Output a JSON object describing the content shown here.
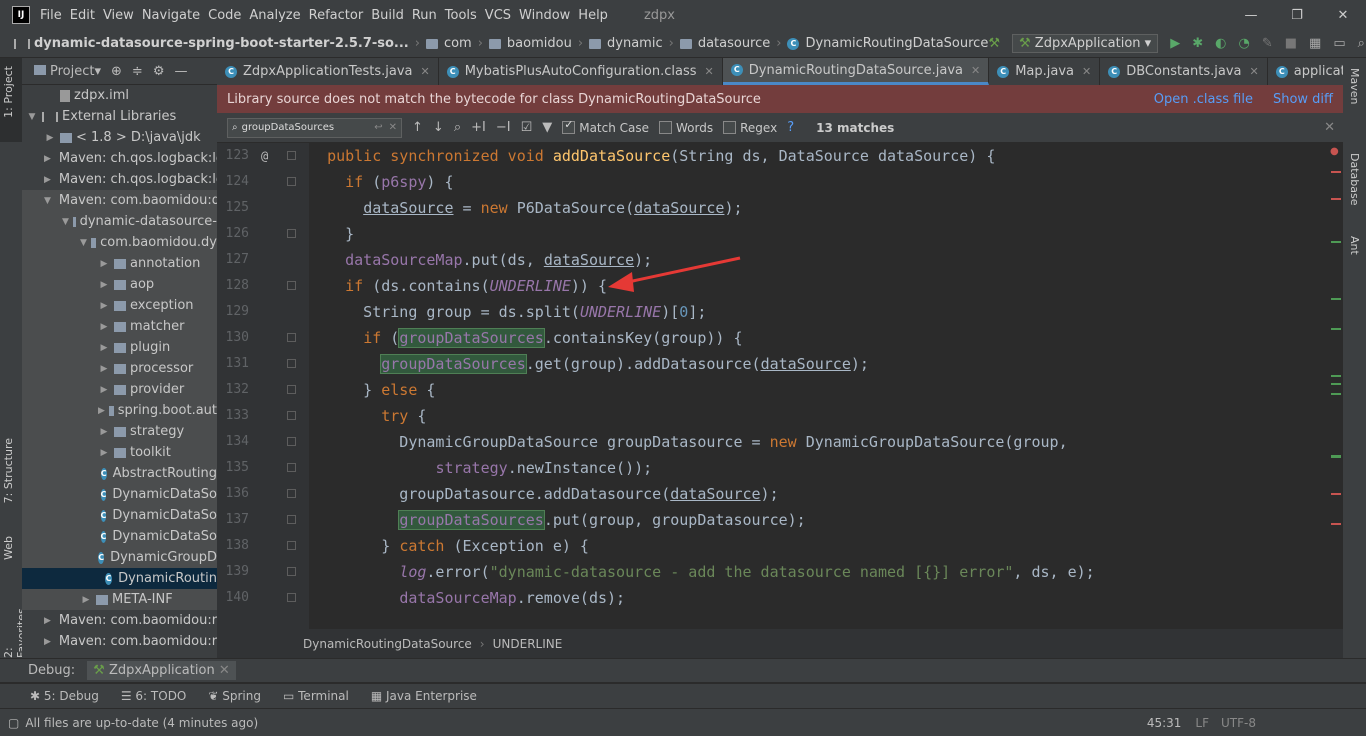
{
  "app": {
    "title": "zdpx",
    "logo_text": "IJ"
  },
  "menu": [
    "File",
    "Edit",
    "View",
    "Navigate",
    "Code",
    "Analyze",
    "Refactor",
    "Build",
    "Run",
    "Tools",
    "VCS",
    "Window",
    "Help"
  ],
  "breadcrumb": [
    "dynamic-datasource-spring-boot-starter-2.5.7-so...",
    "com",
    "baomidou",
    "dynamic",
    "datasource",
    "DynamicRoutingDataSource"
  ],
  "run_config": "ZdpxApplication",
  "left_tabs": {
    "project": "1: Project",
    "structure": "7: Structure",
    "web": "Web",
    "favorites": "2: Favorites"
  },
  "right_tabs": {
    "maven": "Maven",
    "database": "Database",
    "ant": "Ant"
  },
  "project": {
    "header": "Project",
    "tree": [
      {
        "label": "zdpx.iml",
        "indent": 1,
        "arrow": "",
        "icon": "file"
      },
      {
        "label": "External Libraries",
        "indent": 0,
        "arrow": "▼",
        "icon": "lib"
      },
      {
        "label": "< 1.8 >  D:\\java\\jdk",
        "indent": 1,
        "arrow": "▶",
        "icon": "pkg"
      },
      {
        "label": "Maven: ch.qos.logback:lo",
        "indent": 1,
        "arrow": "▶",
        "icon": "pkg"
      },
      {
        "label": "Maven: ch.qos.logback:lo",
        "indent": 1,
        "arrow": "▶",
        "icon": "pkg"
      },
      {
        "label": "Maven: com.baomidou:d",
        "indent": 1,
        "arrow": "▼",
        "icon": "pkg",
        "hl": true
      },
      {
        "label": "dynamic-datasource-",
        "indent": 2,
        "arrow": "▼",
        "icon": "pkg",
        "hl": true
      },
      {
        "label": "com.baomidou.dy",
        "indent": 3,
        "arrow": "▼",
        "icon": "pkg",
        "hl": true
      },
      {
        "label": "annotation",
        "indent": 4,
        "arrow": "▶",
        "icon": "pkg",
        "hl": true
      },
      {
        "label": "aop",
        "indent": 4,
        "arrow": "▶",
        "icon": "pkg",
        "hl": true
      },
      {
        "label": "exception",
        "indent": 4,
        "arrow": "▶",
        "icon": "pkg",
        "hl": true
      },
      {
        "label": "matcher",
        "indent": 4,
        "arrow": "▶",
        "icon": "pkg",
        "hl": true
      },
      {
        "label": "plugin",
        "indent": 4,
        "arrow": "▶",
        "icon": "pkg",
        "hl": true
      },
      {
        "label": "processor",
        "indent": 4,
        "arrow": "▶",
        "icon": "pkg",
        "hl": true
      },
      {
        "label": "provider",
        "indent": 4,
        "arrow": "▶",
        "icon": "pkg",
        "hl": true
      },
      {
        "label": "spring.boot.aut",
        "indent": 4,
        "arrow": "▶",
        "icon": "pkg",
        "hl": true
      },
      {
        "label": "strategy",
        "indent": 4,
        "arrow": "▶",
        "icon": "pkg",
        "hl": true
      },
      {
        "label": "toolkit",
        "indent": 4,
        "arrow": "▶",
        "icon": "pkg",
        "hl": true
      },
      {
        "label": "AbstractRouting",
        "indent": 4,
        "arrow": "",
        "icon": "cls",
        "hl": true
      },
      {
        "label": "DynamicDataSo",
        "indent": 4,
        "arrow": "",
        "icon": "cls",
        "hl": true
      },
      {
        "label": "DynamicDataSo",
        "indent": 4,
        "arrow": "",
        "icon": "cls",
        "hl": true
      },
      {
        "label": "DynamicDataSo",
        "indent": 4,
        "arrow": "",
        "icon": "cls",
        "hl": true
      },
      {
        "label": "DynamicGroupD",
        "indent": 4,
        "arrow": "",
        "icon": "cls",
        "hl": true
      },
      {
        "label": "DynamicRoutin",
        "indent": 4,
        "arrow": "",
        "icon": "cls",
        "sel": true
      },
      {
        "label": "META-INF",
        "indent": 3,
        "arrow": "▶",
        "icon": "pkg",
        "hl": true
      },
      {
        "label": "Maven: com.baomidou:r",
        "indent": 1,
        "arrow": "▶",
        "icon": "pkg"
      },
      {
        "label": "Maven: com.baomidou:r",
        "indent": 1,
        "arrow": "▶",
        "icon": "pkg"
      }
    ]
  },
  "tabs": [
    {
      "label": "ZdpxApplicationTests.java",
      "active": false
    },
    {
      "label": "MybatisPlusAutoConfiguration.class",
      "active": false
    },
    {
      "label": "DynamicRoutingDataSource.java",
      "active": true
    },
    {
      "label": "Map.java",
      "active": false
    },
    {
      "label": "DBConstants.java",
      "active": false
    },
    {
      "label": "application.yml",
      "active": false
    }
  ],
  "banner": {
    "message": "Library source does not match the bytecode for class DynamicRoutingDataSource",
    "open_class": "Open .class file",
    "show_diff": "Show diff"
  },
  "search": {
    "query": "groupDataSources",
    "match_case": "Match Case",
    "words": "Words",
    "regex": "Regex",
    "help": "?",
    "matches": "13 matches",
    "match_case_checked": true,
    "words_checked": false,
    "regex_checked": false
  },
  "lines": [
    "123",
    "124",
    "125",
    "126",
    "127",
    "128",
    "129",
    "130",
    "131",
    "132",
    "133",
    "134",
    "135",
    "136",
    "137",
    "138",
    "139",
    "140"
  ],
  "editor_breadcrumb": [
    "DynamicRoutingDataSource",
    "UNDERLINE"
  ],
  "debug": {
    "label": "Debug:",
    "config": "ZdpxApplication"
  },
  "tool_windows": [
    "5: Debug",
    "6: TODO",
    "Spring",
    "Terminal",
    "Java Enterprise"
  ],
  "status": {
    "message": "All files are up-to-date (4 minutes ago)",
    "position": "45:31",
    "line_sep": "LF",
    "encoding": "UTF-8"
  },
  "colors": {
    "accent": "#4a88c7",
    "banner": "#733d3d",
    "match": "#32593d"
  }
}
